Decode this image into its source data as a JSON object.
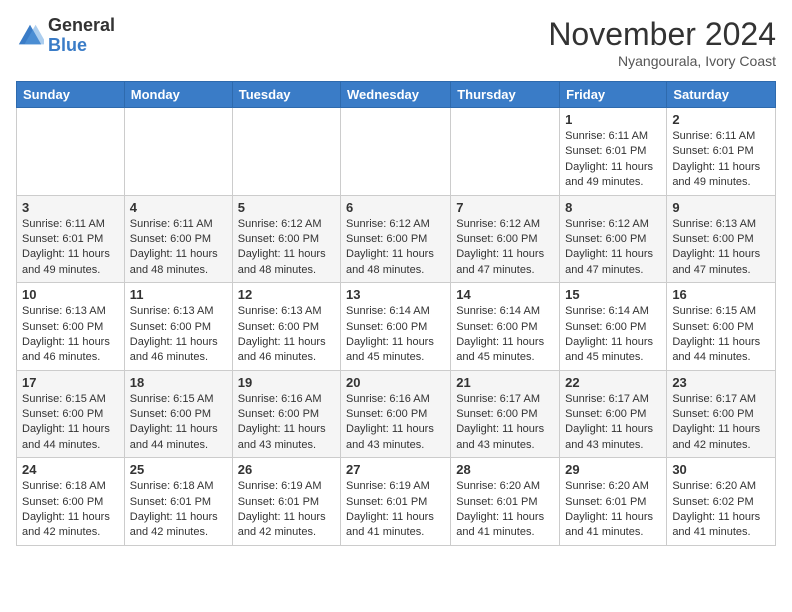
{
  "header": {
    "logo_general": "General",
    "logo_blue": "Blue",
    "month_year": "November 2024",
    "location": "Nyangourala, Ivory Coast"
  },
  "weekdays": [
    "Sunday",
    "Monday",
    "Tuesday",
    "Wednesday",
    "Thursday",
    "Friday",
    "Saturday"
  ],
  "weeks": [
    [
      {
        "day": "",
        "info": ""
      },
      {
        "day": "",
        "info": ""
      },
      {
        "day": "",
        "info": ""
      },
      {
        "day": "",
        "info": ""
      },
      {
        "day": "",
        "info": ""
      },
      {
        "day": "1",
        "info": "Sunrise: 6:11 AM\nSunset: 6:01 PM\nDaylight: 11 hours\nand 49 minutes."
      },
      {
        "day": "2",
        "info": "Sunrise: 6:11 AM\nSunset: 6:01 PM\nDaylight: 11 hours\nand 49 minutes."
      }
    ],
    [
      {
        "day": "3",
        "info": "Sunrise: 6:11 AM\nSunset: 6:01 PM\nDaylight: 11 hours\nand 49 minutes."
      },
      {
        "day": "4",
        "info": "Sunrise: 6:11 AM\nSunset: 6:00 PM\nDaylight: 11 hours\nand 48 minutes."
      },
      {
        "day": "5",
        "info": "Sunrise: 6:12 AM\nSunset: 6:00 PM\nDaylight: 11 hours\nand 48 minutes."
      },
      {
        "day": "6",
        "info": "Sunrise: 6:12 AM\nSunset: 6:00 PM\nDaylight: 11 hours\nand 48 minutes."
      },
      {
        "day": "7",
        "info": "Sunrise: 6:12 AM\nSunset: 6:00 PM\nDaylight: 11 hours\nand 47 minutes."
      },
      {
        "day": "8",
        "info": "Sunrise: 6:12 AM\nSunset: 6:00 PM\nDaylight: 11 hours\nand 47 minutes."
      },
      {
        "day": "9",
        "info": "Sunrise: 6:13 AM\nSunset: 6:00 PM\nDaylight: 11 hours\nand 47 minutes."
      }
    ],
    [
      {
        "day": "10",
        "info": "Sunrise: 6:13 AM\nSunset: 6:00 PM\nDaylight: 11 hours\nand 46 minutes."
      },
      {
        "day": "11",
        "info": "Sunrise: 6:13 AM\nSunset: 6:00 PM\nDaylight: 11 hours\nand 46 minutes."
      },
      {
        "day": "12",
        "info": "Sunrise: 6:13 AM\nSunset: 6:00 PM\nDaylight: 11 hours\nand 46 minutes."
      },
      {
        "day": "13",
        "info": "Sunrise: 6:14 AM\nSunset: 6:00 PM\nDaylight: 11 hours\nand 45 minutes."
      },
      {
        "day": "14",
        "info": "Sunrise: 6:14 AM\nSunset: 6:00 PM\nDaylight: 11 hours\nand 45 minutes."
      },
      {
        "day": "15",
        "info": "Sunrise: 6:14 AM\nSunset: 6:00 PM\nDaylight: 11 hours\nand 45 minutes."
      },
      {
        "day": "16",
        "info": "Sunrise: 6:15 AM\nSunset: 6:00 PM\nDaylight: 11 hours\nand 44 minutes."
      }
    ],
    [
      {
        "day": "17",
        "info": "Sunrise: 6:15 AM\nSunset: 6:00 PM\nDaylight: 11 hours\nand 44 minutes."
      },
      {
        "day": "18",
        "info": "Sunrise: 6:15 AM\nSunset: 6:00 PM\nDaylight: 11 hours\nand 44 minutes."
      },
      {
        "day": "19",
        "info": "Sunrise: 6:16 AM\nSunset: 6:00 PM\nDaylight: 11 hours\nand 43 minutes."
      },
      {
        "day": "20",
        "info": "Sunrise: 6:16 AM\nSunset: 6:00 PM\nDaylight: 11 hours\nand 43 minutes."
      },
      {
        "day": "21",
        "info": "Sunrise: 6:17 AM\nSunset: 6:00 PM\nDaylight: 11 hours\nand 43 minutes."
      },
      {
        "day": "22",
        "info": "Sunrise: 6:17 AM\nSunset: 6:00 PM\nDaylight: 11 hours\nand 43 minutes."
      },
      {
        "day": "23",
        "info": "Sunrise: 6:17 AM\nSunset: 6:00 PM\nDaylight: 11 hours\nand 42 minutes."
      }
    ],
    [
      {
        "day": "24",
        "info": "Sunrise: 6:18 AM\nSunset: 6:00 PM\nDaylight: 11 hours\nand 42 minutes."
      },
      {
        "day": "25",
        "info": "Sunrise: 6:18 AM\nSunset: 6:01 PM\nDaylight: 11 hours\nand 42 minutes."
      },
      {
        "day": "26",
        "info": "Sunrise: 6:19 AM\nSunset: 6:01 PM\nDaylight: 11 hours\nand 42 minutes."
      },
      {
        "day": "27",
        "info": "Sunrise: 6:19 AM\nSunset: 6:01 PM\nDaylight: 11 hours\nand 41 minutes."
      },
      {
        "day": "28",
        "info": "Sunrise: 6:20 AM\nSunset: 6:01 PM\nDaylight: 11 hours\nand 41 minutes."
      },
      {
        "day": "29",
        "info": "Sunrise: 6:20 AM\nSunset: 6:01 PM\nDaylight: 11 hours\nand 41 minutes."
      },
      {
        "day": "30",
        "info": "Sunrise: 6:20 AM\nSunset: 6:02 PM\nDaylight: 11 hours\nand 41 minutes."
      }
    ]
  ]
}
